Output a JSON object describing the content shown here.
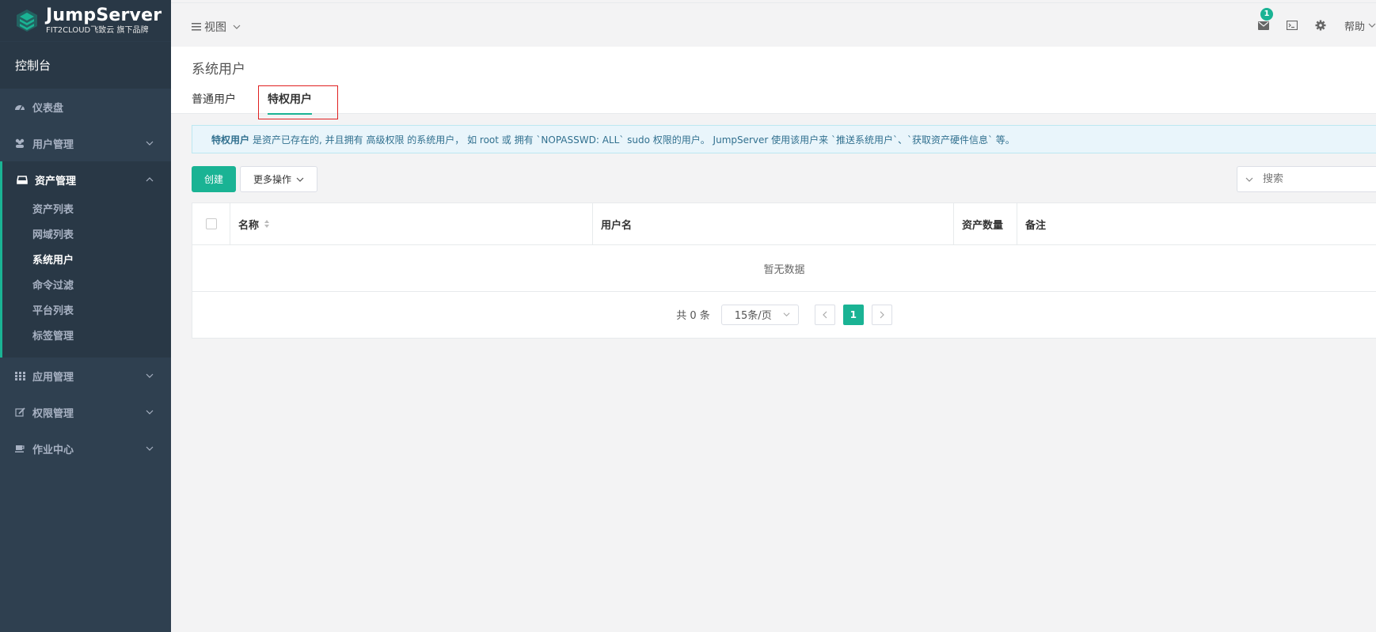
{
  "brand": {
    "name": "JumpServer",
    "subtitle": "FIT2CLOUD飞致云 旗下品牌"
  },
  "sidebar": {
    "console_label": "控制台",
    "dashboard": "仪表盘",
    "users": "用户管理",
    "assets": {
      "label": "资产管理",
      "items": [
        "资产列表",
        "网域列表",
        "系统用户",
        "命令过滤",
        "平台列表",
        "标签管理"
      ]
    },
    "apps": "应用管理",
    "perms": "权限管理",
    "ops": "作业中心"
  },
  "topbar": {
    "view_label": "视图",
    "mail_badge": "1",
    "help_label": "帮助"
  },
  "page": {
    "title": "系统用户",
    "tabs": [
      "普通用户",
      "特权用户"
    ],
    "active_tab": "特权用户"
  },
  "alert": {
    "strong": "特权用户",
    "text": "是资产已存在的, 并且拥有 高级权限 的系统用户， 如 root 或 拥有 `NOPASSWD: ALL` sudo 权限的用户。 JumpServer 使用该用户来 `推送系统用户`、`获取资产硬件信息` 等。"
  },
  "toolbar": {
    "create_label": "创建",
    "more_label": "更多操作",
    "search_placeholder": "搜索"
  },
  "table": {
    "columns": [
      "名称",
      "用户名",
      "资产数量",
      "备注"
    ],
    "empty_text": "暂无数据"
  },
  "pagination": {
    "total_text": "共 0 条",
    "page_size": "15条/页",
    "current_page": "1"
  },
  "colors": {
    "accent": "#1ab394",
    "sidebar_bg": "#2f4050",
    "alert_text": "#31708f"
  }
}
